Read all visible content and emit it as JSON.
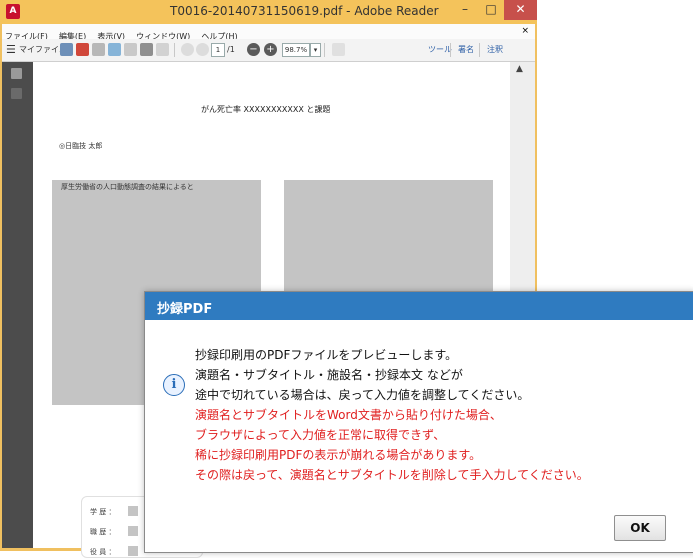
{
  "window": {
    "title": "T0016-20140731150619.pdf - Adobe Reader",
    "app_icon_text": "A",
    "min_label": "–",
    "max_label": "□",
    "close_label": "✕"
  },
  "menu": {
    "items": [
      "ファイル(F)",
      "編集(E)",
      "表示(V)",
      "ウィンドウ(W)",
      "ヘルプ(H)"
    ],
    "close_label": "×"
  },
  "toolbar": {
    "hamburger": "☰",
    "myfile": "マイファイル",
    "page_current": "1",
    "page_total": "/1",
    "zoom": "98.7%",
    "zoom_out": "−",
    "zoom_in": "+",
    "tools": "ツール",
    "sign": "署名",
    "comment": "注釈"
  },
  "pdf": {
    "title": "がん死亡率 XXXXXXXXXXX と課題",
    "author": "◎日臨技 太郎",
    "body_start": "厚生労働省の人口動態調査の結果によると",
    "table_rows": [
      {
        "label": "学  歴  ："
      },
      {
        "label": "職  歴  ："
      },
      {
        "label": "役  員  ："
      }
    ]
  },
  "dialog": {
    "title": "抄録PDF",
    "icon": "i",
    "lines_black": [
      "抄録印刷用のPDFファイルをプレビューします。",
      "演題名・サブタイトル・施設名・抄録本文 などが",
      "途中で切れている場合は、戻って入力値を調整してください。"
    ],
    "lines_red": [
      "演題名とサブタイトルをWord文書から貼り付けた場合、",
      "ブラウザによって入力値を正常に取得できず、",
      "稀に抄録印刷用PDFの表示が崩れる場合があります。",
      "その際は戻って、演題名とサブタイトルを削除して手入力してください。"
    ],
    "ok_label": "OK"
  },
  "colors": {
    "reader_frame": "#f4c35b",
    "dialog_title": "#2f7bc0",
    "warning_text": "#e02020",
    "page_gray": "#c4c4c4"
  }
}
